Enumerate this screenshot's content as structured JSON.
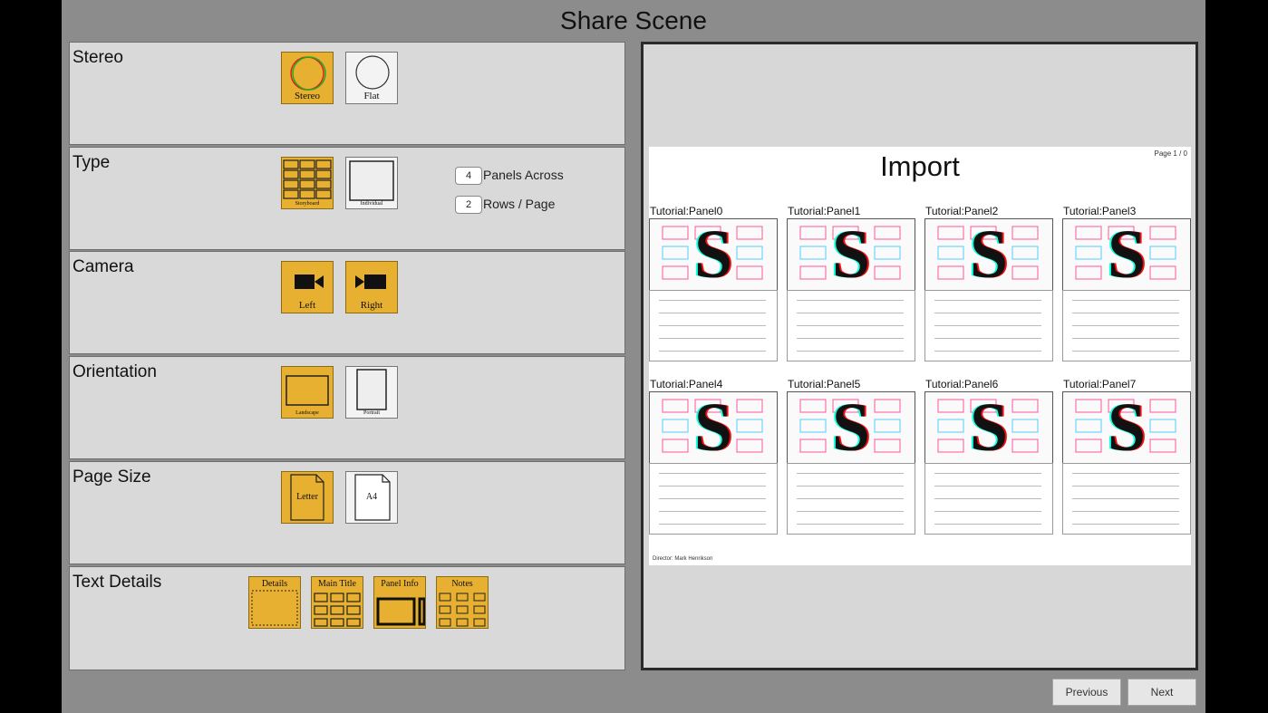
{
  "window": {
    "title": "Share Scene"
  },
  "settings": {
    "stereo": {
      "label": "Stereo",
      "options": [
        "Stereo",
        "Flat"
      ],
      "selected": "Stereo"
    },
    "type": {
      "label": "Type",
      "options": [
        "Storyboard",
        "Individual"
      ],
      "selected": "Storyboard",
      "panels_across": {
        "value": "4",
        "label": "Panels Across"
      },
      "rows_per_page": {
        "value": "2",
        "label": "Rows / Page"
      }
    },
    "camera": {
      "label": "Camera",
      "options": [
        "Left",
        "Right"
      ],
      "selected": [
        "Left",
        "Right"
      ]
    },
    "orientation": {
      "label": "Orientation",
      "options": [
        "Landscape",
        "Portrait"
      ],
      "selected": "Landscape"
    },
    "page_size": {
      "label": "Page Size",
      "options": [
        "Letter",
        "A4"
      ],
      "selected": "Letter"
    },
    "text_details": {
      "label": "Text Details",
      "options": [
        "Details",
        "Main Title",
        "Panel Info",
        "Notes"
      ]
    }
  },
  "preview": {
    "title": "Import",
    "page_number": "Page 1 / 0",
    "director": "Director: Mark Henrikson",
    "panels": [
      "Tutorial:Panel0",
      "Tutorial:Panel1",
      "Tutorial:Panel2",
      "Tutorial:Panel3",
      "Tutorial:Panel4",
      "Tutorial:Panel5",
      "Tutorial:Panel6",
      "Tutorial:Panel7"
    ]
  },
  "buttons": {
    "previous": "Previous",
    "next": "Next"
  },
  "colors": {
    "selected": "#e7b031",
    "panel_bg": "#d9d9d9",
    "window_bg": "#8c8c8c"
  }
}
